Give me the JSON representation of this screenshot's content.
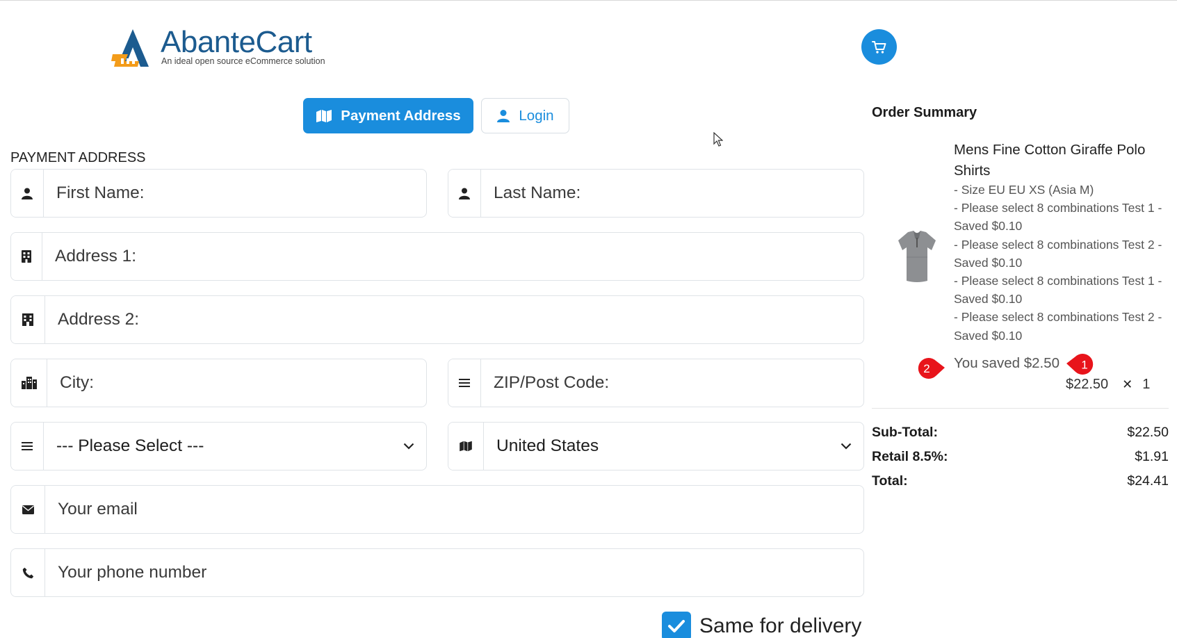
{
  "header": {
    "logo_title": "AbanteCart",
    "logo_tagline": "An ideal open source eCommerce solution",
    "cart_icon": "shopping-cart-icon"
  },
  "steps": {
    "payment_address": "Payment Address",
    "login": "Login"
  },
  "form": {
    "section_title": "PAYMENT ADDRESS",
    "first_name_placeholder": "First Name:",
    "last_name_placeholder": "Last Name:",
    "address1_placeholder": "Address 1:",
    "address2_placeholder": "Address 2:",
    "city_placeholder": "City:",
    "zip_placeholder": "ZIP/Post Code:",
    "zone_selected": "--- Please Select ---",
    "country_selected": "United States",
    "email_placeholder": "Your email",
    "phone_placeholder": "Your phone number",
    "same_for_delivery": "Same for delivery",
    "same_for_delivery_checked": true
  },
  "summary": {
    "title": "Order Summary",
    "product": {
      "name": "Mens Fine Cotton Giraffe Polo Shirts",
      "options": [
        "- Size EU EU XS (Asia M)",
        "- Please select 8 combinations Test 1 - Saved $0.10",
        "- Please select 8 combinations Test 2 - Saved $0.10",
        "- Please select 8 combinations Test 1 - Saved $0.10",
        "- Please select 8 combinations Test 2 - Saved $0.10"
      ],
      "saved": "You saved $2.50",
      "price": "$22.50",
      "times": "✕",
      "quantity": "1"
    },
    "markers": [
      "1",
      "2"
    ],
    "totals": [
      {
        "label": "Sub-Total:",
        "value": "$22.50"
      },
      {
        "label": "Retail 8.5%:",
        "value": "$1.91"
      },
      {
        "label": "Total:",
        "value": "$24.41"
      }
    ]
  },
  "colors": {
    "accent": "#1a8ddd",
    "logo_blue": "#1c5b8f",
    "marker_red": "#e8141b"
  }
}
